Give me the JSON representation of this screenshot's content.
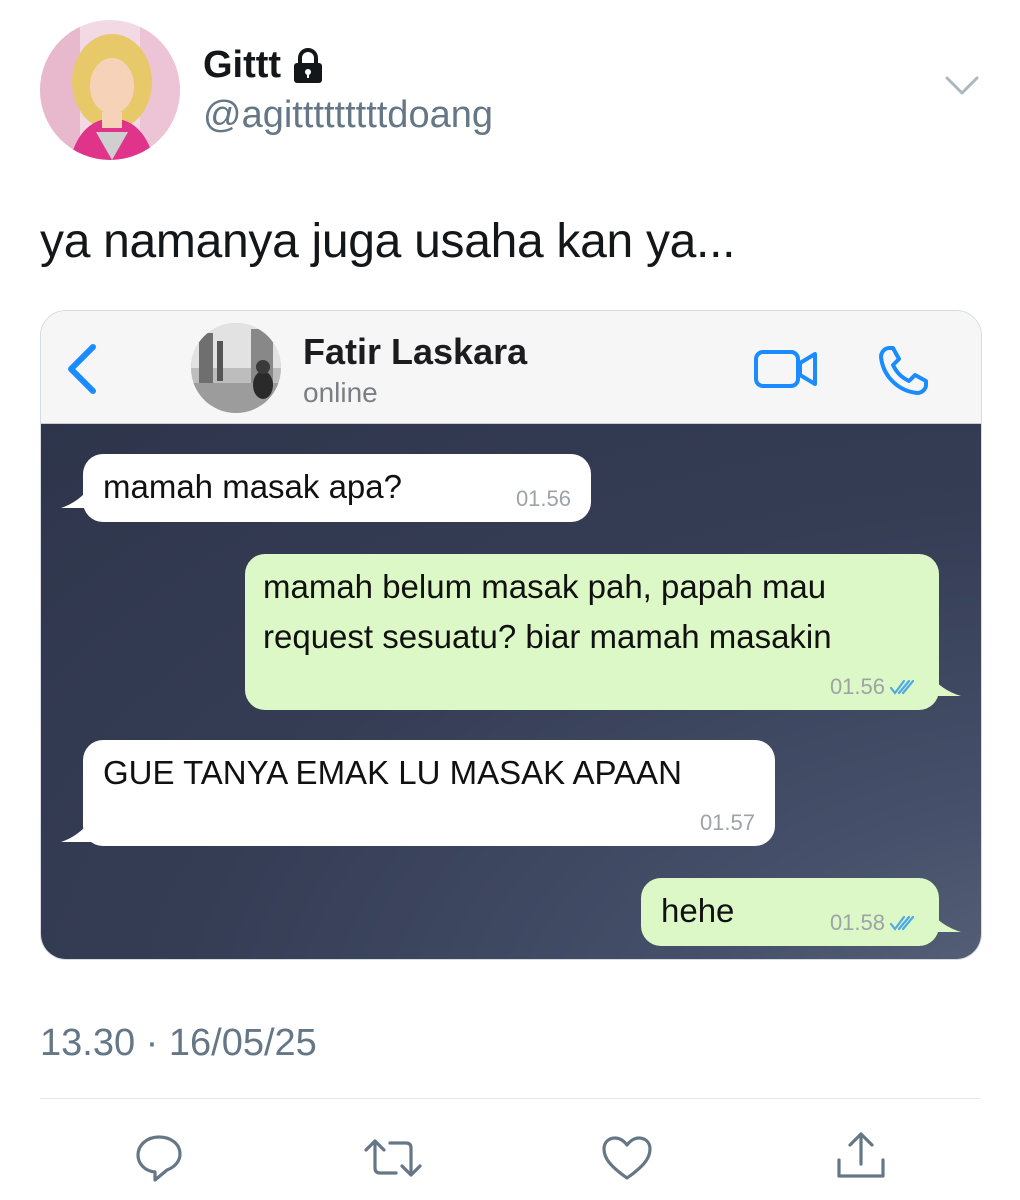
{
  "tweet": {
    "display_name": "Gittt",
    "handle": "@agitttttttttdoang",
    "text": "ya namanya juga usaha kan ya...",
    "timestamp": "13.30 · 16/05/25",
    "icons": [
      "lock-icon",
      "caret-down-icon",
      "reply-icon",
      "retweet-icon",
      "like-icon",
      "share-icon"
    ]
  },
  "chat": {
    "contact_name": "Fatir Laskara",
    "contact_status": "online",
    "icons": [
      "back-chevron-icon",
      "video-call-icon",
      "phone-call-icon",
      "double-check-icon"
    ],
    "colors": {
      "accent": "#1a8cff",
      "incoming_bubble": "#ffffff",
      "outgoing_bubble": "#dcf8c6",
      "background": "#353d55"
    },
    "messages": [
      {
        "direction": "in",
        "text": "mamah masak apa?",
        "time": "01.56"
      },
      {
        "direction": "out",
        "text": "mamah belum masak pah, papah mau\nrequest sesuatu? biar mamah masakin",
        "time": "01.56",
        "read": true
      },
      {
        "direction": "in",
        "text": "GUE TANYA EMAK LU MASAK APAAN",
        "time": "01.57"
      },
      {
        "direction": "out",
        "text": "hehe",
        "time": "01.58",
        "read": true
      }
    ]
  }
}
